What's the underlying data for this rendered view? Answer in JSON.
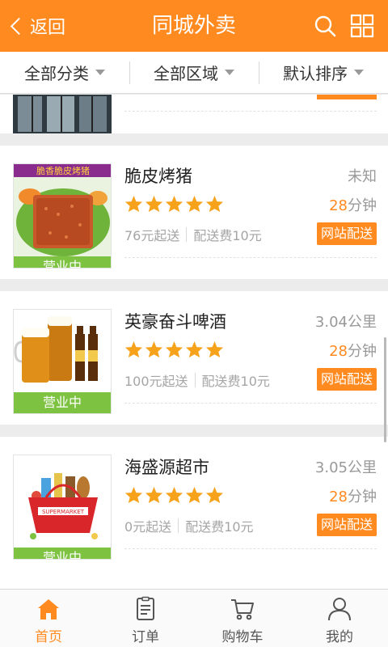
{
  "header": {
    "back_label": "返回",
    "title": "同城外卖",
    "accent_color": "#ff8a1f"
  },
  "filters": [
    {
      "label": "全部分类"
    },
    {
      "label": "全部区域"
    },
    {
      "label": "默认排序"
    }
  ],
  "stores": [
    {
      "name": "脆皮烤猪",
      "distance": "未知",
      "rating": 5,
      "time_num": "28",
      "time_unit": "分钟",
      "min_order": "76元起送",
      "delivery_fee": "配送费10元",
      "badge": "网站配送",
      "status": "营业中",
      "image_banner": "脆香脆皮烤猪"
    },
    {
      "name": "英豪奋斗啤酒",
      "distance": "3.04公里",
      "rating": 5,
      "time_num": "28",
      "time_unit": "分钟",
      "min_order": "100元起送",
      "delivery_fee": "配送费10元",
      "badge": "网站配送",
      "status": "营业中"
    },
    {
      "name": "海盛源超市",
      "distance": "3.05公里",
      "rating": 5,
      "time_num": "28",
      "time_unit": "分钟",
      "min_order": "0元起送",
      "delivery_fee": "配送费10元",
      "badge": "网站配送",
      "status": "营业中",
      "image_banner": "SUPERMARKET"
    }
  ],
  "tabs": [
    {
      "label": "首页",
      "icon": "home-icon",
      "active": true
    },
    {
      "label": "订单",
      "icon": "order-icon",
      "active": false
    },
    {
      "label": "购物车",
      "icon": "cart-icon",
      "active": false
    },
    {
      "label": "我的",
      "icon": "user-icon",
      "active": false
    }
  ]
}
